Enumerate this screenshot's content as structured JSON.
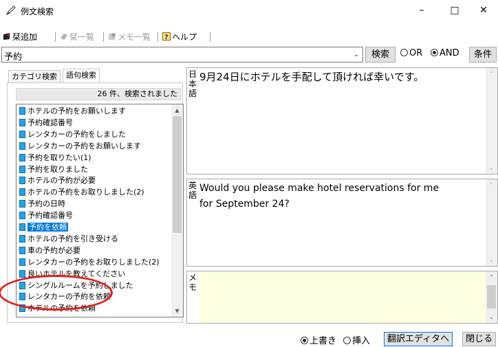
{
  "window": {
    "title": "例文検索",
    "min": "–",
    "max": "□",
    "close": "✕"
  },
  "toolbar": {
    "add_bookmark": "栞追加",
    "bookmark_list": "栞一覧",
    "memo_list": "メモ一覧",
    "help": "ヘルプ"
  },
  "search": {
    "value": "予約",
    "search_button": "検索",
    "or_label": "OR",
    "and_label": "AND",
    "selected_mode": "AND",
    "condition_button": "条件"
  },
  "left_panel": {
    "tabs": [
      "カテゴリ検索",
      "語句検索"
    ],
    "active_tab": "語句検索",
    "result_count": "26 件、検索されました",
    "items": [
      "ホテルの予約をお願いします",
      "予約確認番号",
      "レンタカーの予約をしました",
      "レンタカーの予約をお願いします",
      "予約を取りたい(1)",
      "予約を取りました",
      "ホテルの予約が必要",
      "ホテルの予約をお取りしました(2)",
      "予約の日時",
      "予約確認番号",
      "予約を依頼",
      "ホテルの予約を引き受ける",
      "車の予約が必要",
      "レンタカーの予約をお取りしました(2)",
      "良いホテルを教えてください",
      "シングルルームを予約しました",
      "レンタカーの予約を依頼",
      "ホテルの予約を依頼"
    ],
    "selected_item": "予約を依頼"
  },
  "japanese_pane": {
    "label": "日本語",
    "text": "9月24日にホテルを手配して頂ければ幸いです。"
  },
  "english_pane": {
    "label": "英語",
    "text_line1": "Would you please make hotel reservations for me",
    "text_line2": "for September 24?"
  },
  "memo_pane": {
    "label": "メモ",
    "text": ""
  },
  "statusbar": {
    "overwrite": "上書き",
    "insert": "挿入",
    "selected_mode": "上書き",
    "translation_editor_button": "翻訳エディタへ",
    "close_button": "閉じる"
  },
  "colors": {
    "selection": "#0078d7",
    "memo_background": "#ffffe1",
    "annotation": "#e0201a",
    "doc_icon": "#2aa2e3"
  }
}
